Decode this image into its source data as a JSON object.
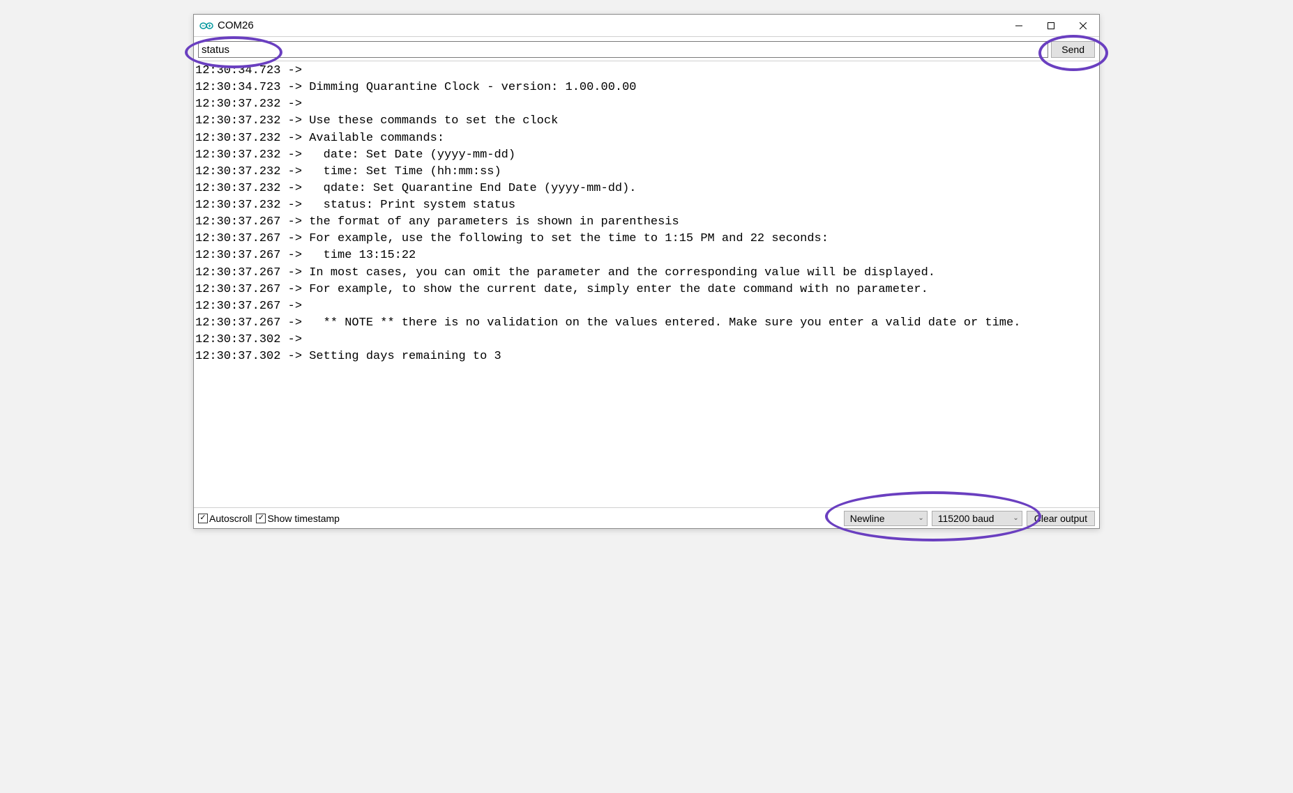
{
  "window": {
    "title": "COM26"
  },
  "input": {
    "value": "status",
    "send_label": "Send"
  },
  "console_lines": [
    {
      "ts": "12:30:34.723",
      "arrow": "->",
      "msg": ""
    },
    {
      "ts": "12:30:34.723",
      "arrow": "->",
      "msg": "Dimming Quarantine Clock - version: 1.00.00.00"
    },
    {
      "ts": "12:30:37.232",
      "arrow": "->",
      "msg": ""
    },
    {
      "ts": "12:30:37.232",
      "arrow": "->",
      "msg": "Use these commands to set the clock"
    },
    {
      "ts": "12:30:37.232",
      "arrow": "->",
      "msg": "Available commands:"
    },
    {
      "ts": "12:30:37.232",
      "arrow": "->",
      "msg": "  date: Set Date (yyyy-mm-dd)"
    },
    {
      "ts": "12:30:37.232",
      "arrow": "->",
      "msg": "  time: Set Time (hh:mm:ss)"
    },
    {
      "ts": "12:30:37.232",
      "arrow": "->",
      "msg": "  qdate: Set Quarantine End Date (yyyy-mm-dd)."
    },
    {
      "ts": "12:30:37.232",
      "arrow": "->",
      "msg": "  status: Print system status"
    },
    {
      "ts": "12:30:37.267",
      "arrow": "->",
      "msg": "the format of any parameters is shown in parenthesis"
    },
    {
      "ts": "12:30:37.267",
      "arrow": "->",
      "msg": "For example, use the following to set the time to 1:15 PM and 22 seconds:"
    },
    {
      "ts": "12:30:37.267",
      "arrow": "->",
      "msg": "  time 13:15:22"
    },
    {
      "ts": "12:30:37.267",
      "arrow": "->",
      "msg": "In most cases, you can omit the parameter and the corresponding value will be displayed."
    },
    {
      "ts": "12:30:37.267",
      "arrow": "->",
      "msg": "For example, to show the current date, simply enter the date command with no parameter."
    },
    {
      "ts": "12:30:37.267",
      "arrow": "->",
      "msg": ""
    },
    {
      "ts": "12:30:37.267",
      "arrow": "->",
      "msg": "  ** NOTE ** there is no validation on the values entered. Make sure you enter a valid date or time."
    },
    {
      "ts": "12:30:37.302",
      "arrow": "->",
      "msg": ""
    },
    {
      "ts": "12:30:37.302",
      "arrow": "->",
      "msg": "Setting days remaining to 3"
    }
  ],
  "bottom": {
    "autoscroll_label": "Autoscroll",
    "timestamp_label": "Show timestamp",
    "line_ending": "Newline",
    "baud": "115200 baud",
    "clear_label": "Clear output",
    "autoscroll_checked": true,
    "timestamp_checked": true
  },
  "annotation": {
    "color": "#6a3fc0"
  }
}
